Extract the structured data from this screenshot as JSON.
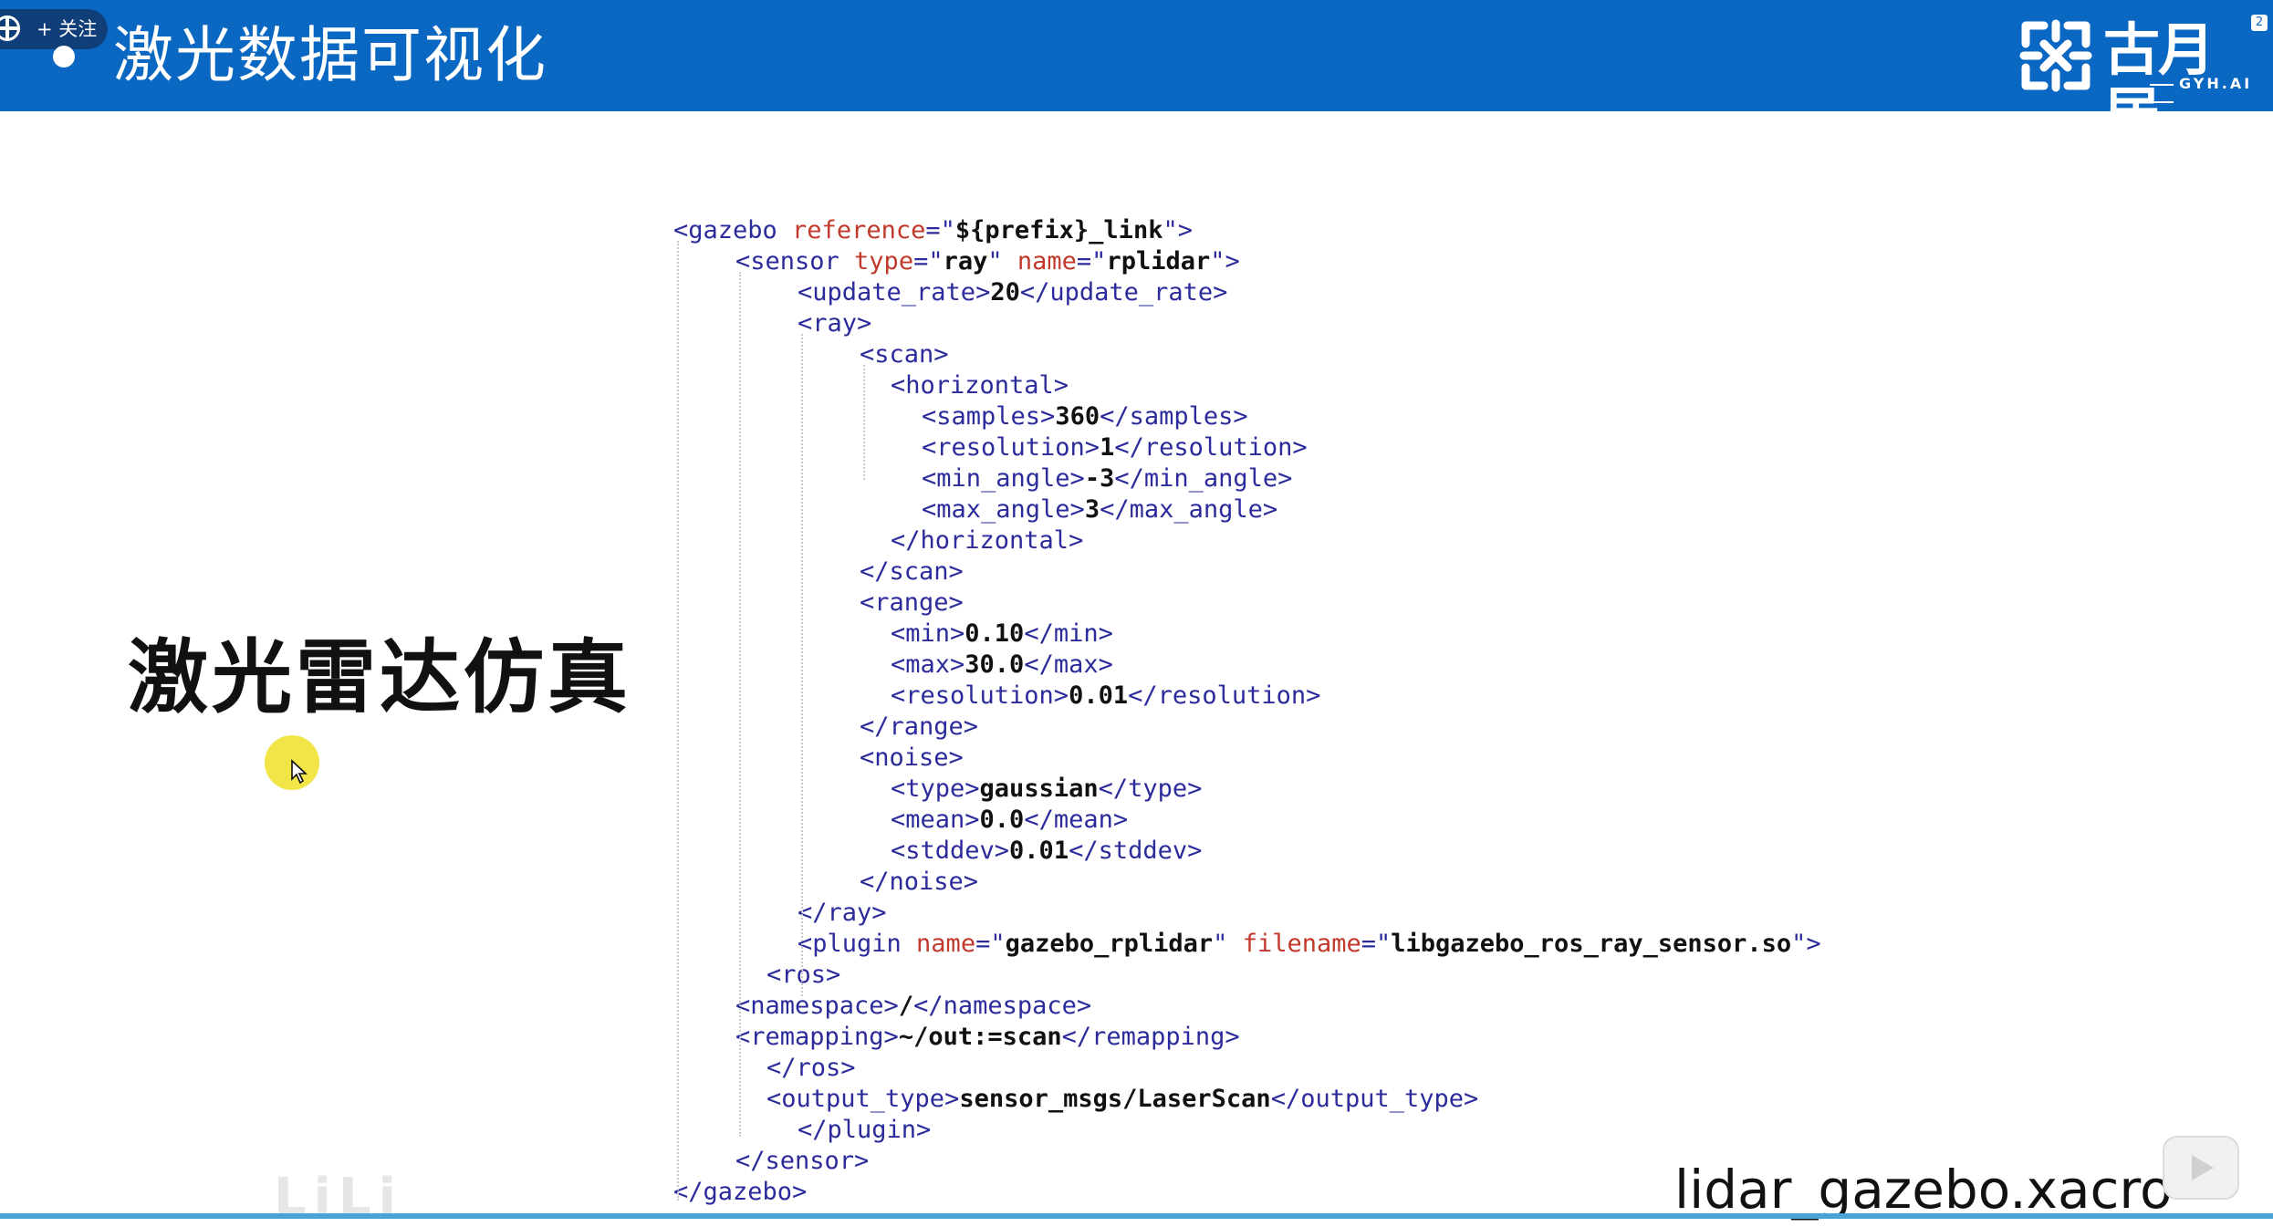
{
  "header": {
    "title": "激光数据可视化",
    "follow_label": "+ 关注",
    "logo_text": "古月居",
    "logo_subtext": "GYH.AI",
    "badge": "2"
  },
  "slide": {
    "heading": "激光雷达仿真",
    "filename": "lidar_gazebo.xacro",
    "ghost_watermark": "LiLi",
    "code_lines": [
      [
        {
          "t": "<gazebo "
        },
        {
          "a": "reference"
        },
        {
          "t": "=\""
        },
        {
          "v": "${prefix}_link"
        },
        {
          "t": "\">"
        }
      ],
      [
        {
          "t": "<sensor "
        },
        {
          "a": "type"
        },
        {
          "t": "=\""
        },
        {
          "v": "ray"
        },
        {
          "t": "\" "
        },
        {
          "a": "name"
        },
        {
          "t": "=\""
        },
        {
          "v": "rplidar"
        },
        {
          "t": "\">"
        }
      ],
      [
        {
          "t": "<update_rate>"
        },
        {
          "b": "20"
        },
        {
          "t": "</update_rate>"
        }
      ],
      [
        {
          "t": "<ray>"
        }
      ],
      [
        {
          "t": "<scan>"
        }
      ],
      [
        {
          "t": "<horizontal>"
        }
      ],
      [
        {
          "t": "<samples>"
        },
        {
          "b": "360"
        },
        {
          "t": "</samples>"
        }
      ],
      [
        {
          "t": "<resolution>"
        },
        {
          "b": "1"
        },
        {
          "t": "</resolution>"
        }
      ],
      [
        {
          "t": "<min_angle>"
        },
        {
          "b": "-3"
        },
        {
          "t": "</min_angle>"
        }
      ],
      [
        {
          "t": "<max_angle>"
        },
        {
          "b": "3"
        },
        {
          "t": "</max_angle>"
        }
      ],
      [
        {
          "t": "</horizontal>"
        }
      ],
      [
        {
          "t": "</scan>"
        }
      ],
      [
        {
          "t": "<range>"
        }
      ],
      [
        {
          "t": "<min>"
        },
        {
          "b": "0.10"
        },
        {
          "t": "</min>"
        }
      ],
      [
        {
          "t": "<max>"
        },
        {
          "b": "30.0"
        },
        {
          "t": "</max>"
        }
      ],
      [
        {
          "t": "<resolution>"
        },
        {
          "b": "0.01"
        },
        {
          "t": "</resolution>"
        }
      ],
      [
        {
          "t": "</range>"
        }
      ],
      [
        {
          "t": "<noise>"
        }
      ],
      [
        {
          "t": "<type>"
        },
        {
          "b": "gaussian"
        },
        {
          "t": "</type>"
        }
      ],
      [
        {
          "t": "<mean>"
        },
        {
          "b": "0.0"
        },
        {
          "t": "</mean>"
        }
      ],
      [
        {
          "t": "<stddev>"
        },
        {
          "b": "0.01"
        },
        {
          "t": "</stddev>"
        }
      ],
      [
        {
          "t": "</noise>"
        }
      ],
      [
        {
          "t": "</ray>"
        }
      ],
      [
        {
          "t": "<plugin "
        },
        {
          "a": "name"
        },
        {
          "t": "=\""
        },
        {
          "v": "gazebo_rplidar"
        },
        {
          "t": "\" "
        },
        {
          "a": "filename"
        },
        {
          "t": "=\""
        },
        {
          "v": "libgazebo_ros_ray_sensor.so"
        },
        {
          "t": "\">"
        }
      ],
      [
        {
          "t": "<ros>"
        }
      ],
      [
        {
          "t": "<namespace>"
        },
        {
          "b": "/"
        },
        {
          "t": "</namespace>"
        }
      ],
      [
        {
          "t": "<remapping>"
        },
        {
          "b": "~/out:=scan"
        },
        {
          "t": "</remapping>"
        }
      ],
      [
        {
          "t": "</ros>"
        }
      ],
      [
        {
          "t": "<output_type>"
        },
        {
          "b": "sensor_msgs/LaserScan"
        },
        {
          "t": "</output_type>"
        }
      ],
      [
        {
          "t": "</plugin>"
        }
      ],
      [
        {
          "t": "</sensor>"
        }
      ],
      [
        {
          "t": "</gazebo>"
        }
      ]
    ]
  },
  "colors": {
    "header_bg": "#0a67c2",
    "tag": "#2b2b9c",
    "attribute": "#c0392b",
    "value": "#111111",
    "cursor_highlight": "#f0e128"
  }
}
